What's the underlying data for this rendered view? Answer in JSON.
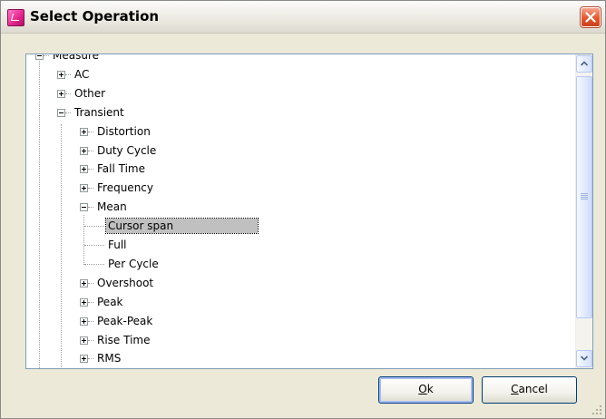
{
  "window": {
    "title": "Select Operation",
    "app_icon": "pink-window-icon",
    "close_icon": "close-icon"
  },
  "tree": {
    "items": [
      {
        "label": "Measure",
        "expander": "minus",
        "level": 0
      },
      {
        "label": "AC",
        "expander": "plus",
        "level": 1
      },
      {
        "label": "Other",
        "expander": "plus",
        "level": 1
      },
      {
        "label": "Transient",
        "expander": "minus",
        "level": 1
      },
      {
        "label": "Distortion",
        "expander": "plus",
        "level": 2
      },
      {
        "label": "Duty Cycle",
        "expander": "plus",
        "level": 2
      },
      {
        "label": "Fall Time",
        "expander": "plus",
        "level": 2
      },
      {
        "label": "Frequency",
        "expander": "plus",
        "level": 2
      },
      {
        "label": "Mean",
        "expander": "minus",
        "level": 2
      },
      {
        "label": "Cursor span",
        "expander": "none",
        "level": 3,
        "selected": true
      },
      {
        "label": "Full",
        "expander": "none",
        "level": 3
      },
      {
        "label": "Per Cycle",
        "expander": "none",
        "level": 3
      },
      {
        "label": "Overshoot",
        "expander": "plus",
        "level": 2
      },
      {
        "label": "Peak",
        "expander": "plus",
        "level": 2
      },
      {
        "label": "Peak-Peak",
        "expander": "plus",
        "level": 2
      },
      {
        "label": "Rise Time",
        "expander": "plus",
        "level": 2
      },
      {
        "label": "RMS",
        "expander": "plus",
        "level": 2
      }
    ]
  },
  "buttons": {
    "ok": {
      "mnemonic": "O",
      "rest": "k"
    },
    "cancel": {
      "mnemonic": "C",
      "rest": "ancel"
    }
  },
  "colors": {
    "selection": "#c0c0c0",
    "panel_border": "#7f9db9",
    "dialog_bg": "#ece9d8",
    "close_red": "#e2582f"
  }
}
